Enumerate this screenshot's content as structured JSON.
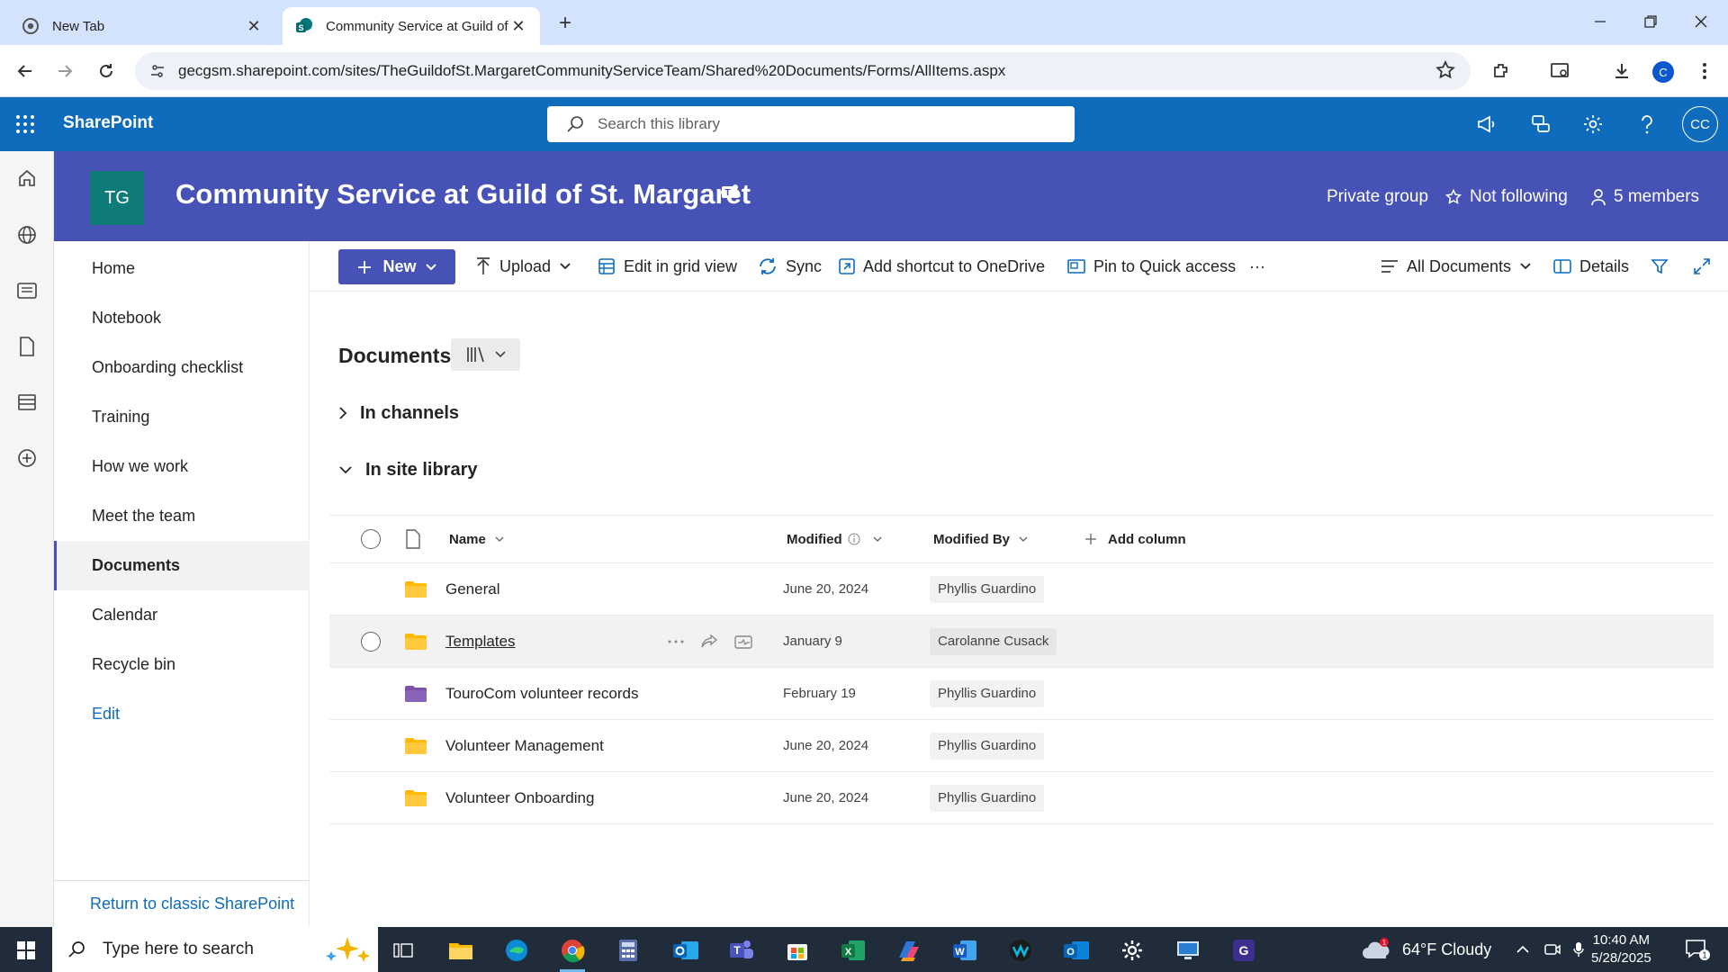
{
  "browser": {
    "tabs": [
      {
        "title": "New Tab",
        "close": "✕"
      },
      {
        "title": "Community Service at Guild of St. Margaret",
        "close": "✕"
      }
    ],
    "new_tab": "+",
    "url": "gecgsm.sharepoint.com/sites/TheGuildofSt.MargaretCommunityServiceTeam/Shared%20Documents/Forms/AllItems.aspx",
    "profile_initial": "C"
  },
  "suite": {
    "brand": "SharePoint",
    "search_placeholder": "Search this library",
    "avatar": "CC",
    "accent": "#0f6cbd"
  },
  "site": {
    "logo": "TG",
    "title": "Community Service at Guild of St. Margaret",
    "privacy": "Private group",
    "follow": "Not following",
    "members": "5 members",
    "header_color": "#4752b6"
  },
  "nav": {
    "items": [
      "Home",
      "Notebook",
      "Onboarding checklist",
      "Training",
      "How we work",
      "Meet the team",
      "Documents",
      "Calendar",
      "Recycle bin"
    ],
    "selected": "Documents",
    "edit": "Edit",
    "classic": "Return to classic SharePoint"
  },
  "commands": {
    "new": "New",
    "upload": "Upload",
    "grid": "Edit in grid view",
    "sync": "Sync",
    "shortcut": "Add shortcut to OneDrive",
    "pin": "Pin to Quick access",
    "more": "···",
    "view": "All Documents",
    "details": "Details"
  },
  "library": {
    "title": "Documents",
    "sections": {
      "channels": "In channels",
      "site": "In site library"
    },
    "columns": {
      "name": "Name",
      "modified": "Modified",
      "modified_by": "Modified By",
      "add": "Add column"
    },
    "rows": [
      {
        "name": "General",
        "modified": "June 20, 2024",
        "by": "Phyllis Guardino",
        "folder_color": "#ffb900"
      },
      {
        "name": "Templates",
        "modified": "January 9",
        "by": "Carolanne Cusack",
        "folder_color": "#ffb900"
      },
      {
        "name": "TouroCom volunteer records",
        "modified": "February 19",
        "by": "Phyllis Guardino",
        "folder_color": "#8764b8"
      },
      {
        "name": "Volunteer Management",
        "modified": "June 20, 2024",
        "by": "Phyllis Guardino",
        "folder_color": "#ffb900"
      },
      {
        "name": "Volunteer Onboarding",
        "modified": "June 20, 2024",
        "by": "Phyllis Guardino",
        "folder_color": "#ffb900"
      }
    ]
  },
  "taskbar": {
    "search_placeholder": "Type here to search",
    "weather": "64°F Cloudy",
    "weather_badge": "1",
    "time": "10:40 AM",
    "date": "5/28/2025",
    "notifications": "1"
  }
}
